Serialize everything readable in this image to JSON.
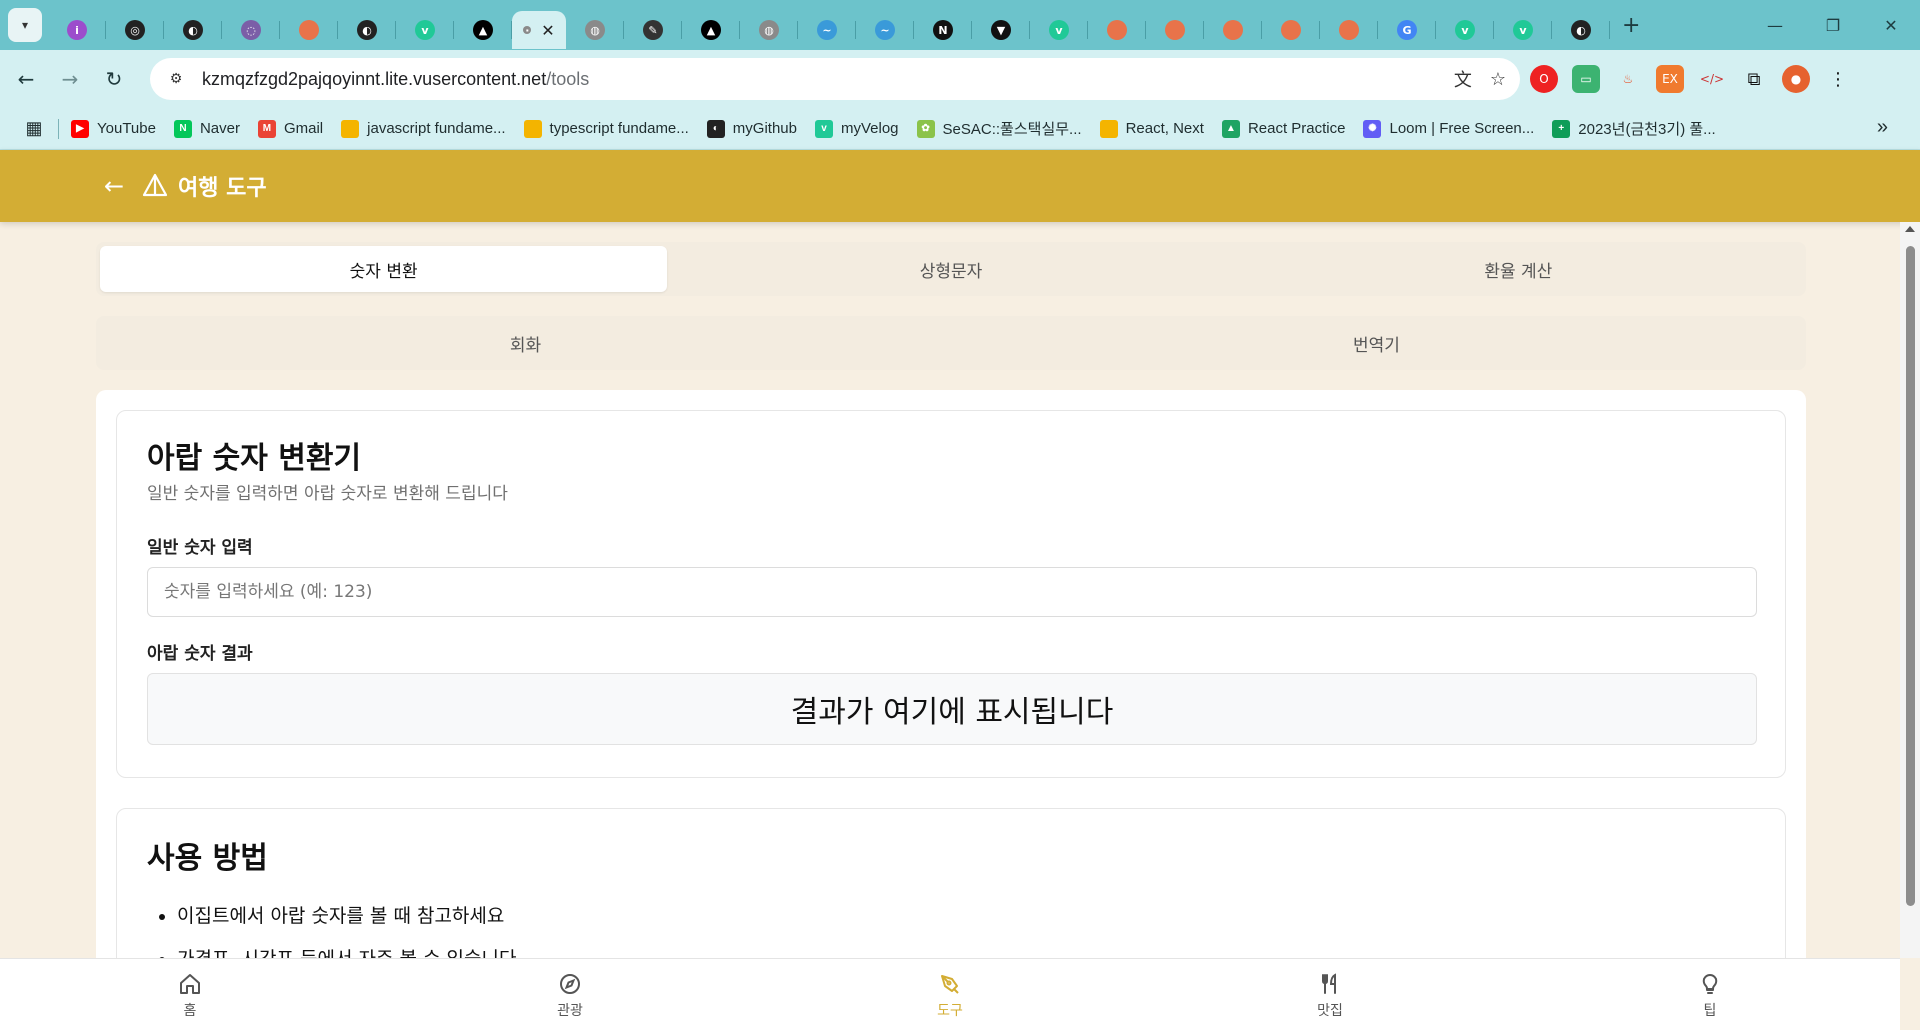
{
  "browser": {
    "tabs": [
      {
        "icon": "purple-badge-icon",
        "color": "#9c4dcc",
        "letter": "i"
      },
      {
        "icon": "chatgpt-icon",
        "color": "#222222",
        "letter": "◎"
      },
      {
        "icon": "github-icon",
        "color": "#222222",
        "letter": "◐"
      },
      {
        "icon": "spiral-icon",
        "color": "#7b5ea7",
        "letter": "◌"
      },
      {
        "icon": "orange-dot-icon",
        "color": "#e8734a",
        "letter": ""
      },
      {
        "icon": "github-icon",
        "color": "#222222",
        "letter": "◐"
      },
      {
        "icon": "velog-icon",
        "color": "#20c997",
        "letter": "v"
      },
      {
        "icon": "vercel-icon",
        "color": "#000000",
        "letter": "▲"
      },
      {
        "icon": "globe-icon",
        "color": "#8a8a8a",
        "letter": "·"
      },
      {
        "icon": "globe-icon",
        "color": "#8a8a8a",
        "letter": "◍"
      },
      {
        "icon": "pen-icon",
        "color": "#333333",
        "letter": "✎"
      },
      {
        "icon": "vercel-icon",
        "color": "#000000",
        "letter": "▲"
      },
      {
        "icon": "globe-icon",
        "color": "#8a8a8a",
        "letter": "◍"
      },
      {
        "icon": "blue-wave-icon",
        "color": "#3a9ad9",
        "letter": "~"
      },
      {
        "icon": "blue-wave-icon",
        "color": "#3a9ad9",
        "letter": "~"
      },
      {
        "icon": "notion-icon",
        "color": "#111111",
        "letter": "N"
      },
      {
        "icon": "graduation-icon",
        "color": "#111111",
        "letter": "▼"
      },
      {
        "icon": "velog-icon",
        "color": "#20c997",
        "letter": "v"
      },
      {
        "icon": "orange-dot-icon",
        "color": "#e8734a",
        "letter": ""
      },
      {
        "icon": "orange-dot-icon",
        "color": "#e8734a",
        "letter": ""
      },
      {
        "icon": "orange-dot-icon",
        "color": "#e8734a",
        "letter": ""
      },
      {
        "icon": "orange-dot-icon",
        "color": "#e8734a",
        "letter": ""
      },
      {
        "icon": "orange-dot-icon",
        "color": "#e8734a",
        "letter": ""
      },
      {
        "icon": "google-icon",
        "color": "#4285f4",
        "letter": "G"
      },
      {
        "icon": "velog-icon",
        "color": "#20c997",
        "letter": "v"
      },
      {
        "icon": "velog-icon",
        "color": "#20c997",
        "letter": "v"
      },
      {
        "icon": "github-icon",
        "color": "#222222",
        "letter": "◐"
      }
    ],
    "active_tab_index": 8,
    "url_host": "kzmqzfzgd2pajqoyinnt.lite.vusercontent.net",
    "url_path": "/tools",
    "bookmarks": [
      {
        "label": "YouTube",
        "icon": "youtube-icon",
        "color": "#ff0000",
        "glyph": "▶"
      },
      {
        "label": "Naver",
        "icon": "naver-icon",
        "color": "#03c75a",
        "glyph": "N"
      },
      {
        "label": "Gmail",
        "icon": "gmail-icon",
        "color": "#ea4335",
        "glyph": "M"
      },
      {
        "label": "javascript fundame...",
        "icon": "folder-icon",
        "color": "#f4b400",
        "glyph": ""
      },
      {
        "label": "typescript fundame...",
        "icon": "folder-icon",
        "color": "#f4b400",
        "glyph": ""
      },
      {
        "label": "myGithub",
        "icon": "github-icon",
        "color": "#222222",
        "glyph": "◐"
      },
      {
        "label": "myVelog",
        "icon": "velog-icon",
        "color": "#20c997",
        "glyph": "v"
      },
      {
        "label": "SeSAC::풀스택실무...",
        "icon": "sesac-icon",
        "color": "#8bc34a",
        "glyph": "✿"
      },
      {
        "label": "React, Next",
        "icon": "folder-icon",
        "color": "#f4b400",
        "glyph": ""
      },
      {
        "label": "React Practice",
        "icon": "drive-icon",
        "color": "#1fa463",
        "glyph": "▲"
      },
      {
        "label": "Loom | Free Screen...",
        "icon": "loom-icon",
        "color": "#625df5",
        "glyph": "✺"
      },
      {
        "label": "2023년(금천3기) 풀...",
        "icon": "sheets-icon",
        "color": "#0f9d58",
        "glyph": "+"
      }
    ]
  },
  "app": {
    "title": "여행 도구",
    "accent": "#d3ad34",
    "tabs_row1": [
      "숫자 변환",
      "상형문자",
      "환율 계산"
    ],
    "tabs_row1_selected": 0,
    "tabs_row2": [
      "회화",
      "번역기"
    ]
  },
  "converter": {
    "title": "아랍 숫자 변환기",
    "description": "일반 숫자를 입력하면 아랍 숫자로 변환해 드립니다",
    "input_label": "일반 숫자 입력",
    "input_placeholder": "숫자를 입력하세요 (예: 123)",
    "input_value": "",
    "result_label": "아랍 숫자 결과",
    "result_text": "결과가 여기에 표시됩니다"
  },
  "usage": {
    "title": "사용 방법",
    "items": [
      "이집트에서 아랍 숫자를 볼 때 참고하세요",
      "가격표, 시간표 등에서 자주 볼 수 있습니다"
    ]
  },
  "bottom_nav": [
    {
      "label": "홈",
      "icon": "home-icon"
    },
    {
      "label": "관광",
      "icon": "compass-icon"
    },
    {
      "label": "도구",
      "icon": "pen-tool-icon"
    },
    {
      "label": "맛집",
      "icon": "utensils-icon"
    },
    {
      "label": "팁",
      "icon": "lightbulb-icon"
    }
  ],
  "bottom_nav_active": 2
}
